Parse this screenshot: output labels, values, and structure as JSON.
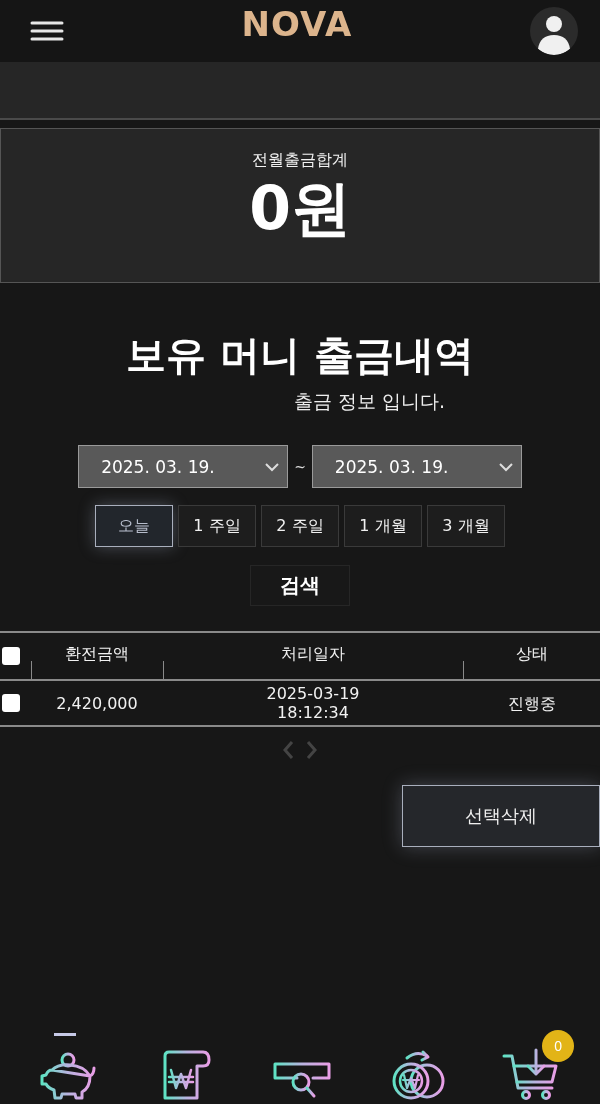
{
  "header": {
    "logo": "NOVA"
  },
  "summary_card": {
    "label": "전월출금합계",
    "value": "0원"
  },
  "section": {
    "title": "보유 머니 출금내역",
    "subtitle": "출금 정보 입니다."
  },
  "date_range": {
    "start": "2025. 03. 19.",
    "separator": "~",
    "end": "2025. 03. 19."
  },
  "periods": [
    {
      "label": "오늘",
      "selected": true
    },
    {
      "label": "1 주일",
      "selected": false
    },
    {
      "label": "2 주일",
      "selected": false
    },
    {
      "label": "1 개월",
      "selected": false
    },
    {
      "label": "3 개월",
      "selected": false
    }
  ],
  "search_button": "검색",
  "table": {
    "select_all": {
      "checked": false
    },
    "columns": [
      "환전금액",
      "처리일자",
      "상태"
    ],
    "rows": [
      {
        "checked": false,
        "amount": "2,420,000",
        "date": "2025-03-19",
        "time": "18:12:34",
        "status": "진행중"
      }
    ]
  },
  "delete_button": "선택삭제",
  "bottom_nav": {
    "items": [
      {
        "kind": "piggy",
        "selected": true
      },
      {
        "kind": "bill",
        "selected": false
      },
      {
        "kind": "search",
        "selected": false
      },
      {
        "kind": "exchange",
        "selected": false
      },
      {
        "kind": "cart",
        "selected": false,
        "badge": "0"
      }
    ]
  }
}
